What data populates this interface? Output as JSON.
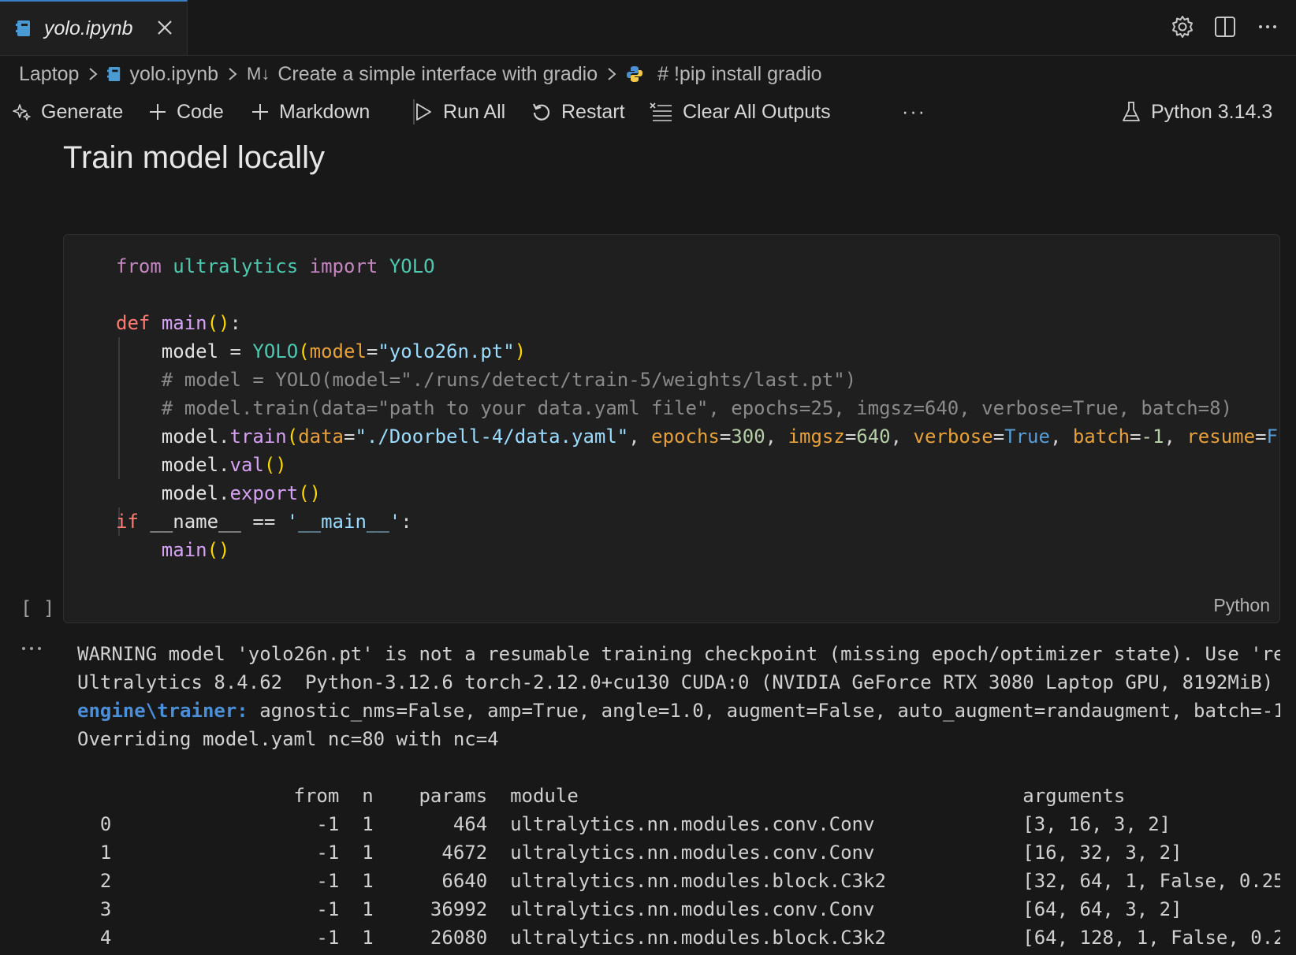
{
  "tab": {
    "title": "yolo.ipynb"
  },
  "breadcrumb": {
    "root": "Laptop",
    "file": "yolo.ipynb",
    "md_prefix": "M↓",
    "section": "Create a simple interface with gradio",
    "cell": "# !pip install gradio"
  },
  "toolbar": {
    "generate": "Generate",
    "code": "Code",
    "markdown": "Markdown",
    "run_all": "Run All",
    "restart": "Restart",
    "clear_outputs": "Clear All Outputs",
    "more": "···",
    "kernel": "Python 3.14.3"
  },
  "heading": "Train model locally",
  "cell": {
    "exec_count": "[ ]",
    "language": "Python",
    "lines": [
      "from ultralytics import YOLO",
      "",
      "def main():",
      "    model = YOLO(model=\"yolo26n.pt\")",
      "    # model = YOLO(model=\"./runs/detect/train-5/weights/last.pt\")",
      "    # model.train(data=\"path to your data.yaml file\", epochs=25, imgsz=640, verbose=True, batch=8)",
      "    model.train(data=\"./Doorbell-4/data.yaml\", epochs=300, imgsz=640, verbose=True, batch=-1, resume=F",
      "    model.val()",
      "    model.export()",
      "if __name__ == '__main__':",
      "    main()"
    ]
  },
  "output": {
    "warning": "WARNING model 'yolo26n.pt' is not a resumable training checkpoint (missing epoch/optimizer state). Use 're",
    "version": "Ultralytics 8.4.62  Python-3.12.6 torch-2.12.0+cu130 CUDA:0 (NVIDIA GeForce RTX 3080 Laptop GPU, 8192MiB)",
    "trainer_label": "engine\\trainer:",
    "trainer_args": " agnostic_nms=False, amp=True, angle=1.0, augment=False, auto_augment=randaugment, batch=-1",
    "override": "Overriding model.yaml nc=80 with nc=4",
    "table": {
      "header": "                   from  n    params  module                                       arguments",
      "rows": [
        "  0                  -1  1       464  ultralytics.nn.modules.conv.Conv             [3, 16, 3, 2]",
        "  1                  -1  1      4672  ultralytics.nn.modules.conv.Conv             [16, 32, 3, 2]",
        "  2                  -1  1      6640  ultralytics.nn.modules.block.C3k2            [32, 64, 1, False, 0.25",
        "  3                  -1  1     36992  ultralytics.nn.modules.conv.Conv             [64, 64, 3, 2]",
        "  4                  -1  1     26080  ultralytics.nn.modules.block.C3k2            [64, 128, 1, False, 0.2"
      ]
    }
  }
}
